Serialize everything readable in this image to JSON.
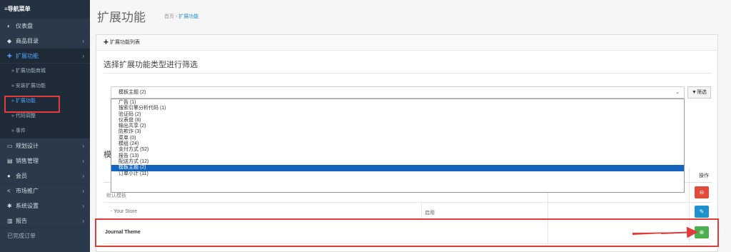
{
  "sidebar": {
    "header": "≡导航菜单",
    "items": [
      {
        "icon": "dashboard-icon",
        "glyph": "◐",
        "label": "仪表盘",
        "chevron": ""
      },
      {
        "icon": "tag-icon",
        "glyph": "◆",
        "label": "商品目录",
        "chevron": "›"
      },
      {
        "icon": "puzzle-icon",
        "glyph": "✚",
        "label": "扩展功能",
        "chevron": "›"
      }
    ],
    "sub_items": [
      "» 扩展功能商城",
      "» 安装扩展功能",
      "» 扩展功能",
      "» 代码调整",
      "» 事件"
    ],
    "more_items": [
      {
        "icon": "monitor-icon",
        "glyph": "▭",
        "label": "规划设计",
        "chevron": "›"
      },
      {
        "icon": "cart-icon",
        "glyph": "▤",
        "label": "销售管理",
        "chevron": "›"
      },
      {
        "icon": "user-icon",
        "glyph": "●",
        "label": "会员",
        "chevron": "›"
      },
      {
        "icon": "share-icon",
        "glyph": "<",
        "label": "市场推广",
        "chevron": "›"
      },
      {
        "icon": "cog-icon",
        "glyph": "✱",
        "label": "系统设置",
        "chevron": "›"
      },
      {
        "icon": "bar-chart-icon",
        "glyph": "▥",
        "label": "报告",
        "chevron": "›"
      }
    ],
    "footer": "已完成订单"
  },
  "page": {
    "title": "扩展功能",
    "breadcrumb_home": "首页",
    "breadcrumb_sep": "›",
    "breadcrumb_current": "扩展功能"
  },
  "panel": {
    "heading": "扩展功能列表",
    "filter_title": "选择扩展功能类型进行筛选",
    "select_value": "模板主题 (2)",
    "filter_button": "▼筛选",
    "options": [
      "广告 (1)",
      "搜索引擎分析代码 (1)",
      "验证码 (2)",
      "仪表盘 (8)",
      "输出共享 (2)",
      "防欺诈 (3)",
      "菜单 (0)",
      "模组 (24)",
      "支付方式 (52)",
      "报告 (13)",
      "配送方式 (12)",
      "模板主题 (2)",
      "订单小计 (11)"
    ],
    "selected_index": 11,
    "section_title": "模",
    "col_operation": "操作",
    "rows": [
      {
        "name": "默认模板",
        "status": ""
      },
      {
        "name": "- Your Store",
        "status": "启用"
      },
      {
        "name": "Journal Theme",
        "status": ""
      }
    ]
  }
}
